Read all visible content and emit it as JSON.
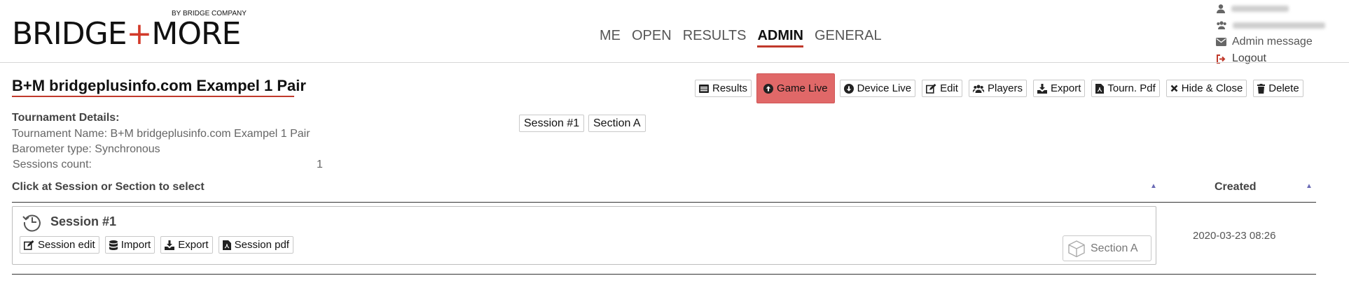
{
  "logo": {
    "text_before": "BRIDGE",
    "plus": "+",
    "text_after": "MORE",
    "by_line": "BY BRIDGE COMPANY"
  },
  "nav": {
    "items": [
      {
        "label": "ME"
      },
      {
        "label": "OPEN"
      },
      {
        "label": "RESULTS"
      },
      {
        "label": "ADMIN",
        "active": true
      },
      {
        "label": "GENERAL"
      }
    ]
  },
  "user_menu": {
    "admin_message": "Admin message",
    "logout": "Logout"
  },
  "page": {
    "title": "B+M bridgeplusinfo.com Exampel 1 Pair"
  },
  "toolbar": {
    "results": "Results",
    "game_live": "Game Live",
    "device_live": "Device Live",
    "edit": "Edit",
    "players": "Players",
    "export": "Export",
    "tourn_pdf": "Tourn. Pdf",
    "hide_close": "Hide & Close",
    "delete": "Delete"
  },
  "details": {
    "heading": "Tournament Details:",
    "name_line": "Tournament Name: B+M bridgeplusinfo.com Exampel 1 Pair",
    "barometer_line": "Barometer type: Synchronous",
    "sessions_label": "Sessions count:",
    "sessions_value": "1"
  },
  "selector": {
    "session": "Session #1",
    "section": "Section A"
  },
  "table": {
    "header_left": "Click at Session or Section to select",
    "header_created": "Created",
    "sort_glyph": "▲",
    "rows": [
      {
        "session": "Session #1",
        "buttons": {
          "session_edit": "Session edit",
          "import": "Import",
          "export": "Export",
          "session_pdf": "Session pdf"
        },
        "section": "Section A",
        "created": "2020-03-23 08:26"
      }
    ]
  },
  "colors": {
    "accent": "#c0392b",
    "highlight": "#e06868",
    "sort_arrow": "#6b6bb5"
  }
}
